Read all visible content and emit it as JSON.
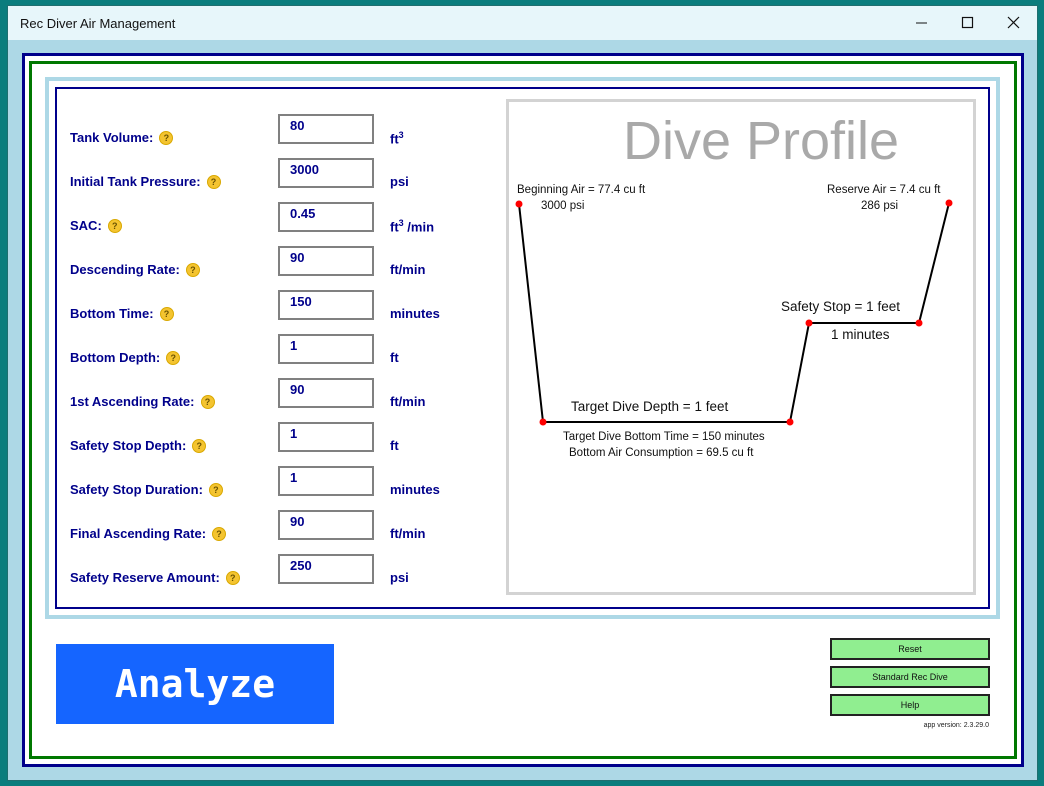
{
  "window": {
    "title": "Rec Diver Air Management"
  },
  "fields": [
    {
      "label": "Tank Volume:",
      "value": "80",
      "unit": "ft",
      "unit_sup": "3",
      "unit_after": ""
    },
    {
      "label": "Initial Tank Pressure:",
      "value": "3000",
      "unit": "psi",
      "unit_sup": "",
      "unit_after": ""
    },
    {
      "label": "SAC:",
      "value": "0.45",
      "unit": "ft",
      "unit_sup": "3",
      "unit_after": " /min"
    },
    {
      "label": "Descending Rate:",
      "value": "90",
      "unit": "ft/min",
      "unit_sup": "",
      "unit_after": ""
    },
    {
      "label": "Bottom Time:",
      "value": "150",
      "unit": "minutes",
      "unit_sup": "",
      "unit_after": ""
    },
    {
      "label": "Bottom Depth:",
      "value": "1",
      "unit": "ft",
      "unit_sup": "",
      "unit_after": ""
    },
    {
      "label": "1st Ascending Rate:",
      "value": "90",
      "unit": "ft/min",
      "unit_sup": "",
      "unit_after": ""
    },
    {
      "label": "Safety Stop Depth:",
      "value": "1",
      "unit": "ft",
      "unit_sup": "",
      "unit_after": ""
    },
    {
      "label": "Safety Stop Duration:",
      "value": "1",
      "unit": "minutes",
      "unit_sup": "",
      "unit_after": ""
    },
    {
      "label": "Final Ascending Rate:",
      "value": "90",
      "unit": "ft/min",
      "unit_sup": "",
      "unit_after": ""
    },
    {
      "label": "Safety Reserve Amount:",
      "value": "250",
      "unit": "psi",
      "unit_sup": "",
      "unit_after": ""
    }
  ],
  "help_icon_glyph": "?",
  "profile": {
    "title": "Dive Profile",
    "beginning_air": "Beginning Air = 77.4 cu ft",
    "beginning_psi": "3000 psi",
    "reserve_air": "Reserve Air = 7.4 cu ft",
    "reserve_psi": "286 psi",
    "safety_stop": "Safety Stop = 1 feet",
    "safety_minutes": "1 minutes",
    "target_depth": "Target Dive Depth = 1 feet",
    "target_time": "Target Dive Bottom Time = 150 minutes",
    "bottom_air": "Bottom Air Consumption = 69.5 cu ft",
    "line_color": "#000000",
    "point_color": "#ff0000"
  },
  "buttons": {
    "analyze": "Analyze",
    "reset": "Reset",
    "standard": "Standard Rec Dive",
    "help": "Help"
  },
  "version": "app version: 2.3.29.0",
  "colors": {
    "label": "#00008b",
    "analyze_bg": "#1565ff",
    "small_btn_bg": "#90ee90",
    "help_icon": "#f4c430"
  }
}
